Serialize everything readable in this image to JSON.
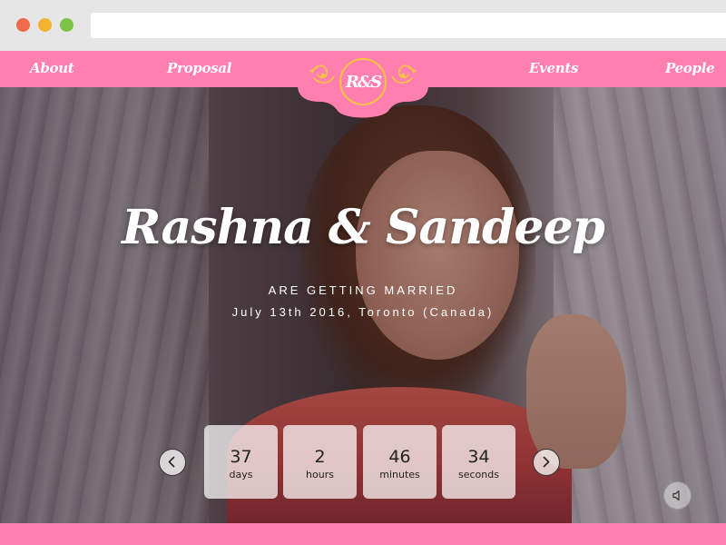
{
  "nav": {
    "about": "About",
    "proposal": "Proposal",
    "events": "Events",
    "people": "People"
  },
  "logo": {
    "monogram": "R&S"
  },
  "hero": {
    "names": "Rashna & Sandeep",
    "subtitle": "ARE GETTING MARRIED",
    "date_line": "July 13th 2016, Toronto (Canada)"
  },
  "countdown": {
    "days": {
      "value": "37",
      "label": "days"
    },
    "hours": {
      "value": "2",
      "label": "hours"
    },
    "minutes": {
      "value": "46",
      "label": "minutes"
    },
    "seconds": {
      "value": "34",
      "label": "seconds"
    }
  },
  "icons": {
    "prev": "chevron-left-icon",
    "next": "chevron-right-icon",
    "sound": "speaker-icon"
  },
  "colors": {
    "brand_pink": "#ff7fae",
    "gold": "#f5c542",
    "chrome": "#e6e6e6"
  }
}
